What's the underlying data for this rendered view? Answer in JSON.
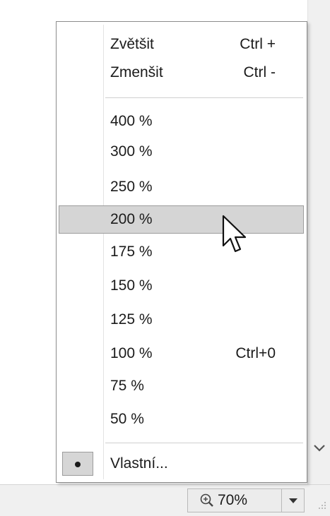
{
  "menu": {
    "top_items": [
      {
        "label": "Zvětšit",
        "shortcut": "Ctrl +"
      },
      {
        "label": "Zmenšit",
        "shortcut": "Ctrl -"
      }
    ],
    "zoom_items": [
      {
        "label": "400 %",
        "shortcut": ""
      },
      {
        "label": "300 %",
        "shortcut": ""
      },
      {
        "label": "250 %",
        "shortcut": ""
      },
      {
        "label": "200 %",
        "shortcut": ""
      },
      {
        "label": "175 %",
        "shortcut": ""
      },
      {
        "label": "150 %",
        "shortcut": ""
      },
      {
        "label": "125 %",
        "shortcut": ""
      },
      {
        "label": "100 %",
        "shortcut": "Ctrl+0"
      },
      {
        "label": "75 %",
        "shortcut": ""
      },
      {
        "label": "50 %",
        "shortcut": ""
      }
    ],
    "highlighted_item": "200 %",
    "custom_item": {
      "label": "Vlastní...",
      "checked": true
    }
  },
  "status_bar": {
    "zoom_value": "70%",
    "zoom_icon": "zoom-in-icon",
    "dropdown_icon": "caret-down-icon"
  },
  "colors": {
    "highlight": "#d5d5d5",
    "menu_border": "#8c8c8c",
    "status_bar": "#f0f0f0"
  }
}
